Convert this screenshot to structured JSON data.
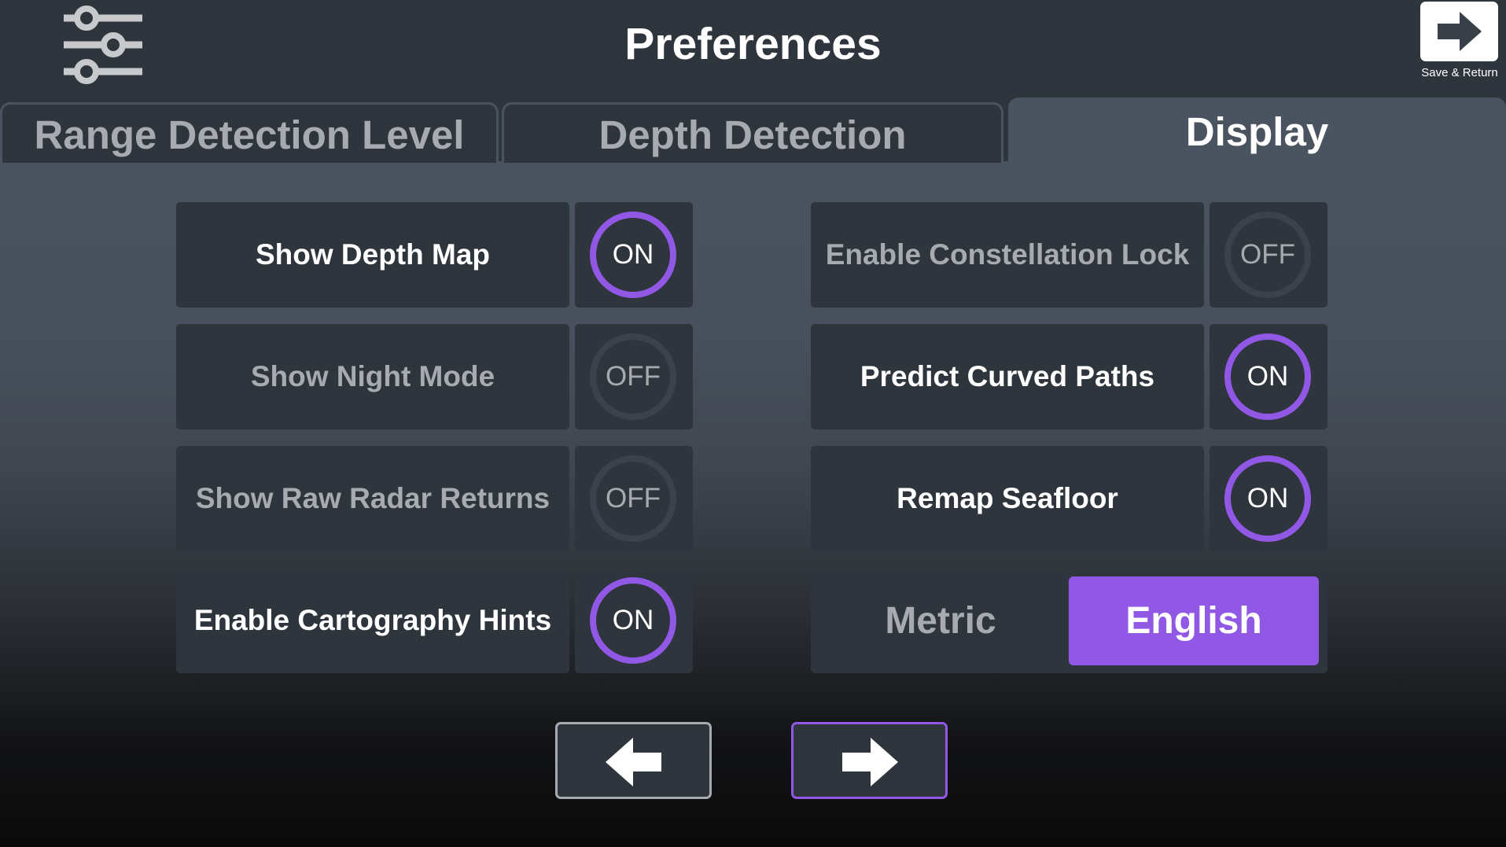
{
  "header": {
    "title": "Preferences",
    "menu_icon": "sliders-icon",
    "save_return": {
      "label": "Save & Return",
      "icon": "arrow-right-icon"
    }
  },
  "tabs": [
    {
      "label": "Range Detection Level",
      "active": false
    },
    {
      "label": "Depth Detection",
      "active": false
    },
    {
      "label": "Display",
      "active": true
    }
  ],
  "settings": {
    "left": [
      {
        "label": "Show Depth Map",
        "state": "ON"
      },
      {
        "label": "Show Night Mode",
        "state": "OFF"
      },
      {
        "label": "Show Raw Radar Returns",
        "state": "OFF"
      },
      {
        "label": "Enable Cartography Hints",
        "state": "ON"
      }
    ],
    "right": [
      {
        "label": "Enable Constellation Lock",
        "state": "OFF"
      },
      {
        "label": "Predict Curved Paths",
        "state": "ON"
      },
      {
        "label": "Remap Seafloor",
        "state": "ON"
      }
    ]
  },
  "units": {
    "options": [
      "Metric",
      "English"
    ],
    "selected": "English"
  },
  "nav": {
    "prev_icon": "arrow-left-icon",
    "next_icon": "arrow-right-icon"
  },
  "colors": {
    "accent": "#9158e6",
    "panel": "#2f353d",
    "muted_text": "#a7abb1"
  }
}
